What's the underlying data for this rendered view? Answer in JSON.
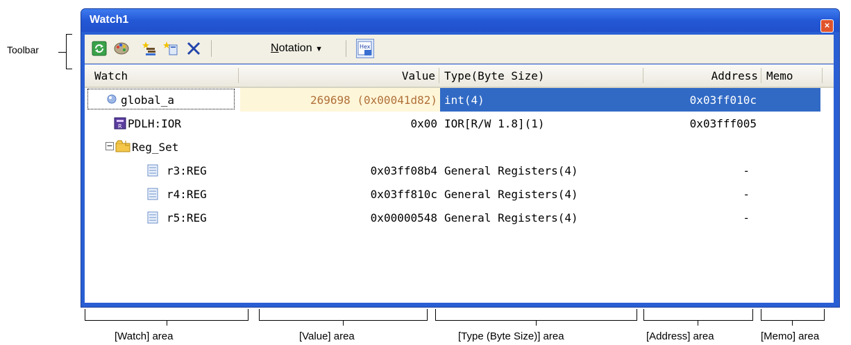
{
  "callout": {
    "toolbar": "Toolbar"
  },
  "window": {
    "title": "Watch1",
    "close_icon": "close-icon"
  },
  "toolbar": {
    "notation_label": "Notation",
    "notation_accesskey": "N",
    "notation_rest": "otation",
    "hex_label": "Hex"
  },
  "columns": {
    "watch": "Watch",
    "value": "Value",
    "type": "Type(Byte Size)",
    "address": "Address",
    "memo": "Memo"
  },
  "rows": [
    {
      "name": "global_a",
      "value": "269698 (0x00041d82)",
      "type": "int(4)",
      "address": "0x03ff010c",
      "memo": "",
      "icon": "variable-icon",
      "selected": true
    },
    {
      "name": "PDLH:IOR",
      "value": "0x00",
      "type": "IOR[R/W 1.8](1)",
      "address": "0x03fff005",
      "memo": "",
      "icon": "io-register-icon"
    },
    {
      "name": "Reg_Set",
      "value": "",
      "type": "",
      "address": "",
      "memo": "",
      "icon": "folder-icon",
      "expander": "⊟"
    },
    {
      "name": "r3:REG",
      "value": "0x03ff08b4",
      "type": "General Registers(4)",
      "address": "-",
      "memo": "",
      "icon": "register-icon"
    },
    {
      "name": "r4:REG",
      "value": "0x03ff810c",
      "type": "General Registers(4)",
      "address": "-",
      "memo": "",
      "icon": "register-icon"
    },
    {
      "name": "r5:REG",
      "value": "0x00000548",
      "type": "General Registers(4)",
      "address": "-",
      "memo": "",
      "icon": "register-icon"
    }
  ],
  "areas": {
    "watch": "[Watch] area",
    "value": "[Value] area",
    "type": "[Type (Byte Size)] area",
    "address": "[Address] area",
    "memo": "[Memo] area"
  },
  "colors": {
    "selection": "#316ac5",
    "value_highlight_bg": "#fef6d8",
    "value_highlight_text": "#b0703a",
    "title_bar": "#2458d6"
  }
}
